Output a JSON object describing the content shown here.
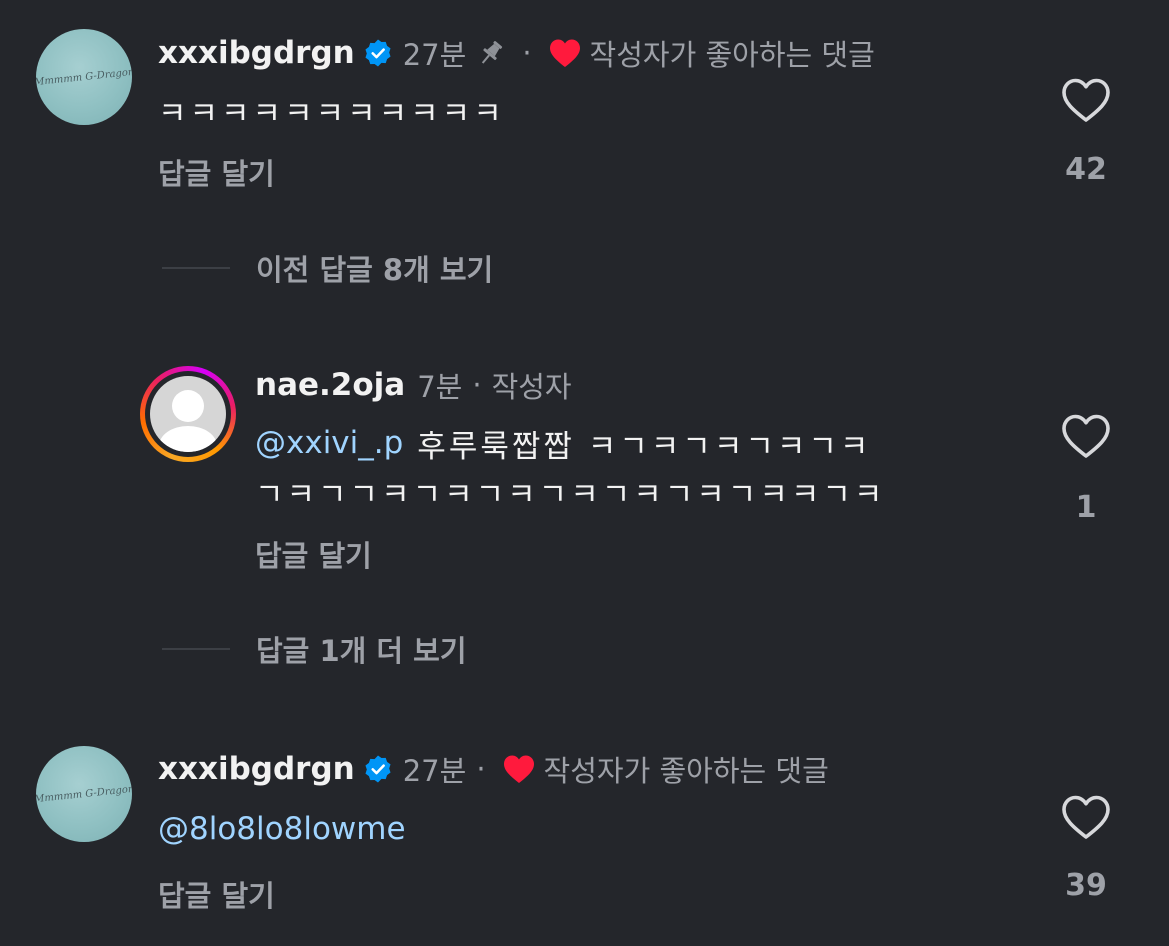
{
  "comments": [
    {
      "avatar_text": "Mmmmm G-Dragon",
      "username": "xxxibgdrgn",
      "time": "27분",
      "liked_by_author_label": "작성자가 좋아하는 댓글",
      "text": "ㅋㅋㅋㅋㅋㅋㅋㅋㅋㅋㅋ",
      "reply_label": "답글 달기",
      "like_count": "42",
      "pinned": true
    },
    {
      "username": "nae.2oja",
      "time": "7분",
      "author_label": "작성자",
      "mention": "@xxivi_.p",
      "text_line1": "후루룩짭짭 ㅋㄱㅋㄱㅋㄱㅋㄱㅋ",
      "text_line2": "ㄱㅋㄱㄱㅋㄱㅋㄱㅋㄱㅋㄱㅋㄱㅋㄱㅋㅋㄱㅋ",
      "reply_label": "답글 달기",
      "like_count": "1"
    },
    {
      "avatar_text": "Mmmmm G-Dragon",
      "username": "xxxibgdrgn",
      "time": "27분",
      "liked_by_author_label": "작성자가 좋아하는 댓글",
      "mention": "@8lo8lo8lowme",
      "reply_label": "답글 달기",
      "like_count": "39"
    }
  ],
  "view_previous_replies": "이전 답글 8개 보기",
  "view_more_replies": "답글 1개 더 보기",
  "separator_dot": "·",
  "colors": {
    "background": "#24262b",
    "verified": "#0095f6",
    "heart": "#ff1a3d",
    "mention": "#a0d4ff",
    "secondary_text": "#9ea1a8"
  },
  "icons": [
    "verified-badge-icon",
    "pin-icon",
    "heart-filled-icon",
    "heart-outline-icon",
    "default-avatar-icon"
  ]
}
